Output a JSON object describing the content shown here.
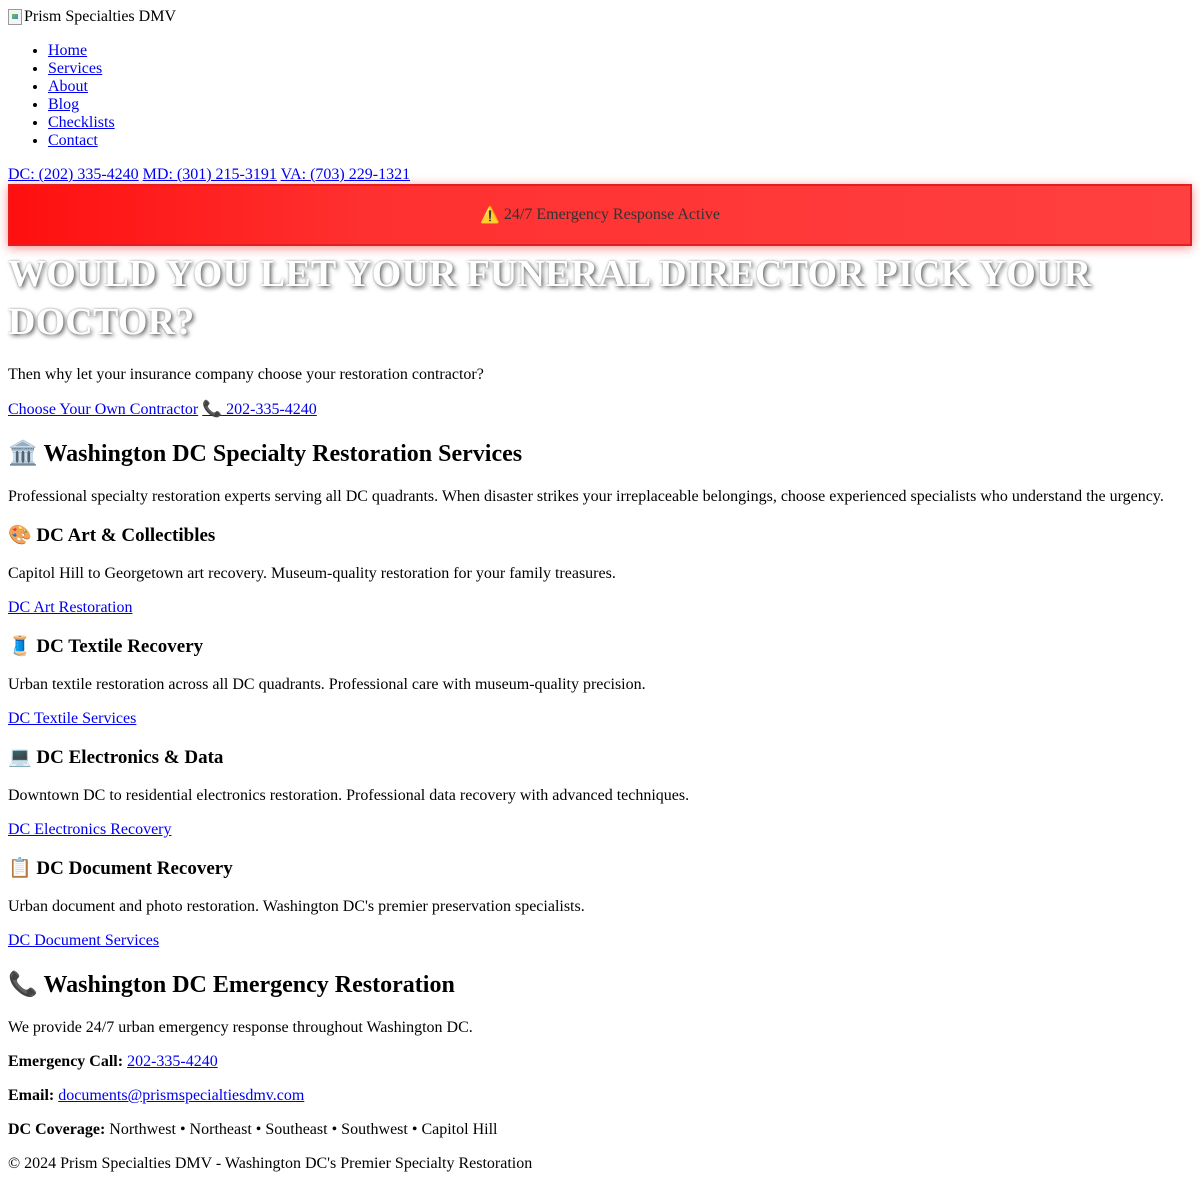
{
  "header": {
    "logo_alt": "Prism Specialties DMV",
    "nav": [
      "Home",
      "Services",
      "About",
      "Blog",
      "Checklists",
      "Contact"
    ],
    "phones": [
      "DC: (202) 335-4240",
      "MD: (301) 215-3191",
      "VA: (703) 229-1321"
    ]
  },
  "alert": {
    "icon": "warning-icon",
    "text": "24/7 Emergency Response Active",
    "color": "#ff1f1f"
  },
  "hero": {
    "title": "Would You Let Your Funeral Director Pick Your Doctor?",
    "subtitle": "Then why let your insurance company choose your restoration contractor?",
    "cta_label": "Choose Your Own Contractor",
    "phone_icon": "📞",
    "phone_label": " 202-335-4240"
  },
  "services": {
    "icon": "🏛️",
    "title": "Washington DC Specialty Restoration Services",
    "intro": "Professional specialty restoration experts serving all DC quadrants. When disaster strikes your irreplaceable belongings, choose experienced specialists who understand the urgency.",
    "items": [
      {
        "icon": "🎨",
        "title": "DC Art & Collectibles",
        "desc": "Capitol Hill to Georgetown art recovery. Museum-quality restoration for your family treasures.",
        "link": "DC Art Restoration"
      },
      {
        "icon": "🧵",
        "title": "DC Textile Recovery",
        "desc": "Urban textile restoration across all DC quadrants. Professional care with museum-quality precision.",
        "link": "DC Textile Services"
      },
      {
        "icon": "💻",
        "title": "DC Electronics & Data",
        "desc": "Downtown DC to residential electronics restoration. Professional data recovery with advanced techniques.",
        "link": "DC Electronics Recovery"
      },
      {
        "icon": "📋",
        "title": "DC Document Recovery",
        "desc": "Urban document and photo restoration. Washington DC's premier preservation specialists.",
        "link": "DC Document Services"
      }
    ]
  },
  "emergency": {
    "icon": "📞",
    "title": "Washington DC Emergency Restoration",
    "intro": "We provide 24/7 urban emergency response throughout Washington DC.",
    "call_label": "Emergency Call:",
    "call_value": "202-335-4240",
    "email_label": "Email:",
    "email_value": "documents@prismspecialtiesdmv.com",
    "coverage_label": "DC Coverage:",
    "coverage_value": " Northwest • Northeast • Southeast • Southwest • Capitol Hill"
  },
  "footer": {
    "copyright": "© 2024 Prism Specialties DMV - Washington DC's Premier Specialty Restoration"
  }
}
